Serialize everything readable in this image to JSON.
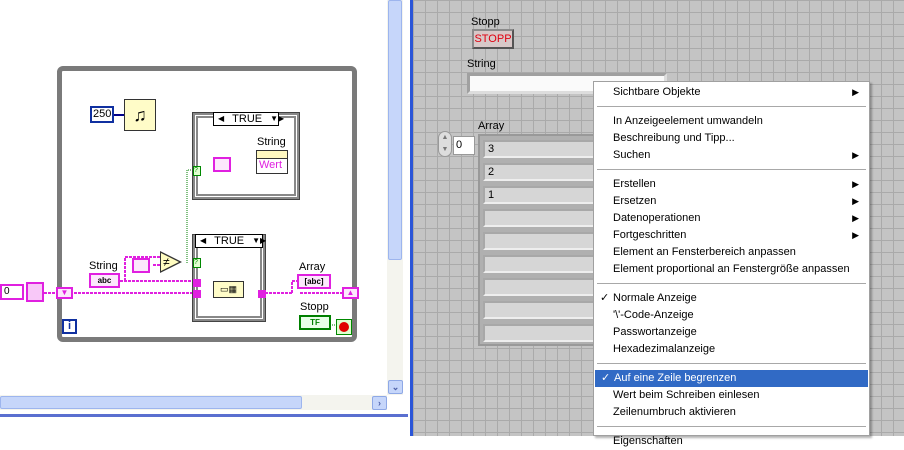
{
  "block_diagram": {
    "wait_ms_constant": "250",
    "case_selector_1": "TRUE",
    "case_selector_2": "TRUE",
    "string_property_label": "String",
    "property_name": "Wert",
    "string_control_label": "String",
    "string_terminal": "abc",
    "array_label": "Array",
    "array_terminal": "[abc]",
    "stop_label": "Stopp",
    "stop_terminal": "TF",
    "init_constant": "0",
    "iteration_terminal": "i",
    "not_equal_symbol": "≠",
    "case_input_symbol": "?"
  },
  "front_panel": {
    "stop_label": "Stopp",
    "stop_button": "STOPP",
    "string_label": "String",
    "string_value": "",
    "array_label": "Array",
    "array_index": "0",
    "array_values": [
      "3",
      "2",
      "1",
      "",
      "",
      "",
      "",
      "",
      ""
    ]
  },
  "context_menu": {
    "items": [
      {
        "label": "Sichtbare Objekte",
        "submenu": true
      },
      {
        "label": "In Anzeigeelement umwandeln"
      },
      {
        "label": "Beschreibung und Tipp..."
      },
      {
        "label": "Suchen",
        "submenu": true
      },
      {
        "label": "Erstellen",
        "submenu": true
      },
      {
        "label": "Ersetzen",
        "submenu": true
      },
      {
        "label": "Datenoperationen",
        "submenu": true
      },
      {
        "label": "Fortgeschritten",
        "submenu": true
      },
      {
        "label": "Element an Fensterbereich anpassen"
      },
      {
        "label": "Element proportional an Fenstergröße anpassen"
      },
      {
        "label": "Normale Anzeige",
        "checked": true
      },
      {
        "label": "'\\'-Code-Anzeige"
      },
      {
        "label": "Passwortanzeige"
      },
      {
        "label": "Hexadezimalanzeige"
      },
      {
        "label": "Auf eine Zeile begrenzen",
        "checked": true,
        "highlighted": true
      },
      {
        "label": "Wert beim Schreiben einlesen"
      },
      {
        "label": "Zeilenumbruch aktivieren"
      },
      {
        "label": "Eigenschaften"
      }
    ],
    "check_glyph": "✓",
    "submenu_glyph": "▶"
  },
  "colors": {
    "string_wire": "#e020e0",
    "highlight": "#316ac5",
    "boolean": "#008000"
  }
}
